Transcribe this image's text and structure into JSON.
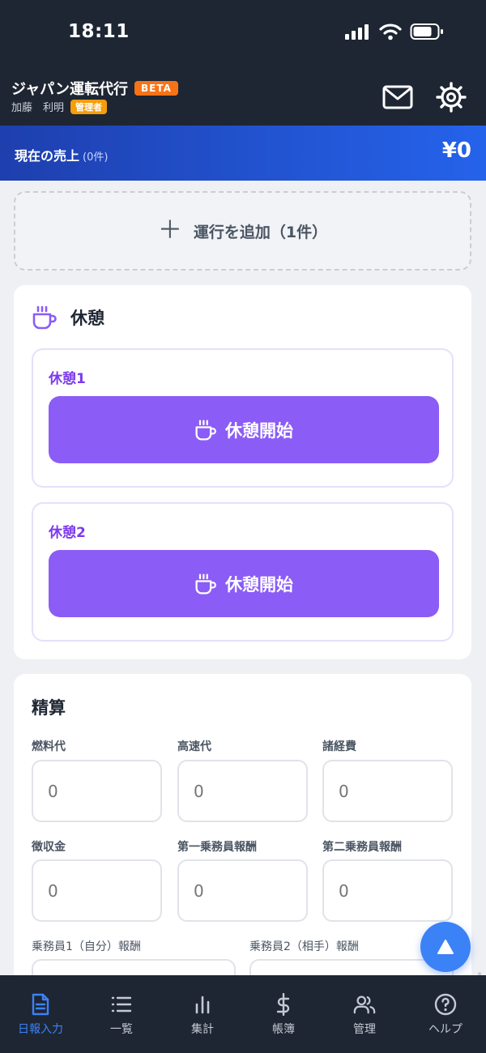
{
  "status_bar": {
    "time": "18:11"
  },
  "header": {
    "app_name": "ジャパン運転代行",
    "beta": "BETA",
    "user_name": "加藤　利明",
    "role": "管理者"
  },
  "sales": {
    "label": "現在の売上",
    "count": "(0件)",
    "amount": "¥0"
  },
  "add_run": {
    "label": "運行を追加（1件）"
  },
  "break_section": {
    "title": "休憩",
    "items": [
      {
        "label": "休憩1",
        "button": "休憩開始"
      },
      {
        "label": "休憩2",
        "button": "休憩開始"
      }
    ]
  },
  "settlement": {
    "title": "精算",
    "fields": [
      {
        "label": "燃料代",
        "value": "0"
      },
      {
        "label": "高速代",
        "value": "0"
      },
      {
        "label": "諸経費",
        "value": "0"
      },
      {
        "label": "徴収金",
        "value": "0"
      },
      {
        "label": "第一乗務員報酬",
        "value": "0"
      },
      {
        "label": "第二乗務員報酬",
        "value": "0"
      }
    ],
    "wide_fields": [
      {
        "label": "乗務員1（自分）報酬"
      },
      {
        "label": "乗務員2（相手）報酬"
      }
    ]
  },
  "tabs": [
    {
      "label": "日報入力",
      "icon": "document-icon",
      "active": true
    },
    {
      "label": "一覧",
      "icon": "list-icon"
    },
    {
      "label": "集計",
      "icon": "bar-chart-icon"
    },
    {
      "label": "帳簿",
      "icon": "dollar-icon"
    },
    {
      "label": "管理",
      "icon": "users-icon"
    },
    {
      "label": "ヘルプ",
      "icon": "help-icon"
    }
  ],
  "colors": {
    "header_bg": "#1e2633",
    "sales_bar": "#2563eb",
    "break_purple": "#8b5cf6",
    "beta_orange": "#f97316",
    "role_amber": "#f59e0b",
    "active_tab": "#3b82f6"
  }
}
